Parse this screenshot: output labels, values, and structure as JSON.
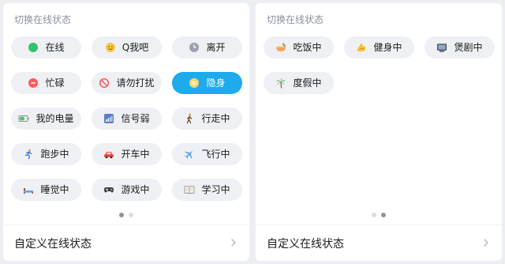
{
  "panels": [
    {
      "title": "切换在线状态",
      "footer_label": "自定义在线状态",
      "page_indicator": {
        "pages": 2,
        "current": 1
      },
      "statuses": [
        {
          "label": "在线",
          "icon": "online-dot-icon",
          "active": false
        },
        {
          "label": "Q我吧",
          "icon": "smile-face-icon",
          "active": false
        },
        {
          "label": "离开",
          "icon": "clock-icon",
          "active": false
        },
        {
          "label": "忙碌",
          "icon": "busy-minus-icon",
          "active": false
        },
        {
          "label": "请勿打扰",
          "icon": "no-entry-icon",
          "active": false
        },
        {
          "label": "隐身",
          "icon": "invisible-icon",
          "active": true
        },
        {
          "label": "我的电量",
          "icon": "battery-icon",
          "active": false
        },
        {
          "label": "信号弱",
          "icon": "weak-signal-icon",
          "active": false
        },
        {
          "label": "行走中",
          "icon": "walking-person-icon",
          "active": false
        },
        {
          "label": "跑步中",
          "icon": "running-person-icon",
          "active": false
        },
        {
          "label": "开车中",
          "icon": "car-icon",
          "active": false
        },
        {
          "label": "飞行中",
          "icon": "airplane-icon",
          "active": false
        },
        {
          "label": "睡觉中",
          "icon": "bed-icon",
          "active": false
        },
        {
          "label": "游戏中",
          "icon": "gamepad-icon",
          "active": false
        },
        {
          "label": "学习中",
          "icon": "open-book-icon",
          "active": false
        }
      ]
    },
    {
      "title": "切换在线状态",
      "footer_label": "自定义在线状态",
      "page_indicator": {
        "pages": 2,
        "current": 2
      },
      "statuses": [
        {
          "label": "吃饭中",
          "icon": "noodle-bowl-icon",
          "active": false
        },
        {
          "label": "健身中",
          "icon": "flexed-bicep-icon",
          "active": false
        },
        {
          "label": "煲剧中",
          "icon": "tv-icon",
          "active": false
        },
        {
          "label": "度假中",
          "icon": "palm-tree-icon",
          "active": false
        }
      ]
    }
  ],
  "colors": {
    "accent": "#1dabec",
    "chip_background": "#eef0f4",
    "panel_background": "#ffffff",
    "page_background": "#eceef2",
    "title_text": "#8a8f99"
  }
}
